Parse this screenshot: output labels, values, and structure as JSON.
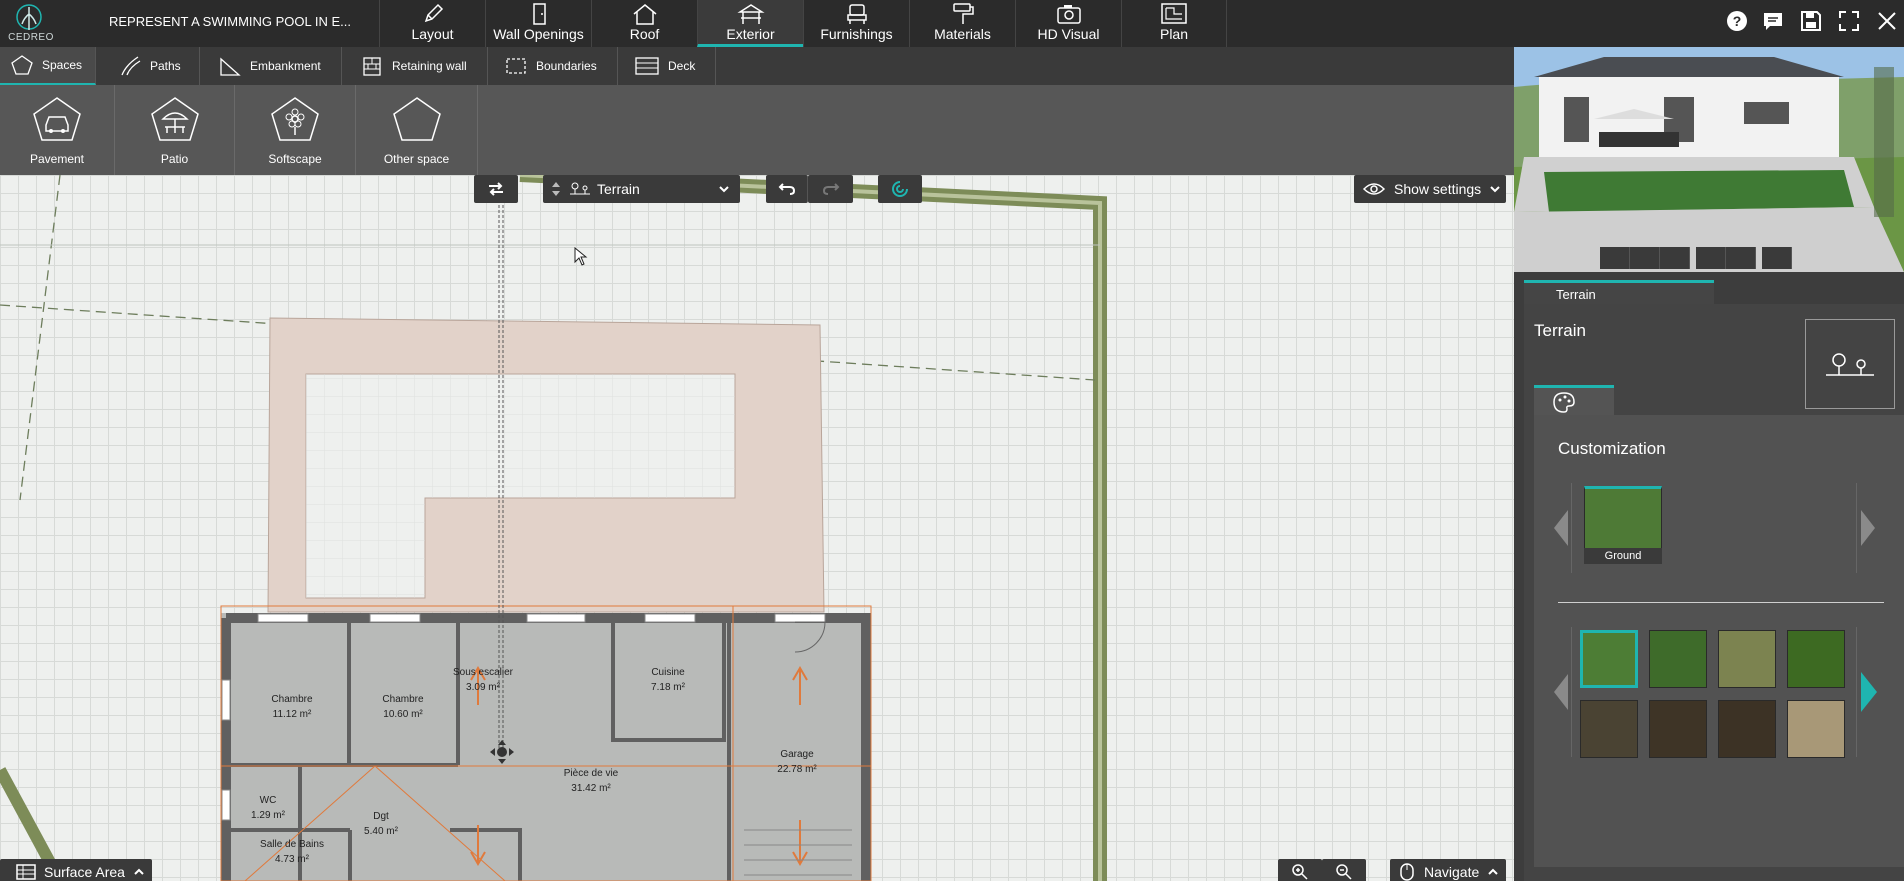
{
  "app": {
    "logo_text": "CEDREO",
    "project_title": "REPRESENT A SWIMMING POOL IN E..."
  },
  "main_tabs": [
    {
      "label": "Layout",
      "icon": "pencil-icon"
    },
    {
      "label": "Wall Openings",
      "icon": "door-icon"
    },
    {
      "label": "Roof",
      "icon": "roof-icon"
    },
    {
      "label": "Exterior",
      "icon": "gazebo-icon",
      "active": true
    },
    {
      "label": "Furnishings",
      "icon": "chair-icon"
    },
    {
      "label": "Materials",
      "icon": "paint-roller-icon"
    },
    {
      "label": "HD Visual",
      "icon": "camera-icon"
    },
    {
      "label": "Plan",
      "icon": "plan-icon"
    }
  ],
  "sub_tabs": [
    {
      "label": "Spaces",
      "active": true
    },
    {
      "label": "Paths"
    },
    {
      "label": "Embankment"
    },
    {
      "label": "Retaining wall"
    },
    {
      "label": "Boundaries"
    },
    {
      "label": "Deck"
    }
  ],
  "space_buttons": [
    {
      "label": "Pavement",
      "icon": "car-pentagon-icon"
    },
    {
      "label": "Patio",
      "icon": "parasol-pentagon-icon"
    },
    {
      "label": "Softscape",
      "icon": "flower-pentagon-icon"
    },
    {
      "label": "Other space",
      "icon": "pentagon-icon"
    }
  ],
  "canvas_controls": {
    "level_select": "Terrain",
    "show_settings": "Show settings",
    "surface_area": "Surface Area",
    "navigate": "Navigate"
  },
  "rooms": [
    {
      "name": "Chambre",
      "area": "11.12 m²"
    },
    {
      "name": "Chambre",
      "area": "10.60 m²"
    },
    {
      "name": "Sous escalier",
      "area": "3.09 m²"
    },
    {
      "name": "Cuisine",
      "area": "7.18 m²"
    },
    {
      "name": "Garage",
      "area": "22.78 m²"
    },
    {
      "name": "Pièce de vie",
      "area": "31.42 m²"
    },
    {
      "name": "WC",
      "area": "1.29 m²"
    },
    {
      "name": "Dgt",
      "area": "5.40 m²"
    },
    {
      "name": "Salle de Bains",
      "area": "4.73 m²"
    }
  ],
  "panel": {
    "tab_label": "Terrain",
    "title": "Terrain",
    "customization_title": "Customization",
    "selected_material": {
      "label": "Ground",
      "color": "#4e7a36"
    },
    "swatches": [
      {
        "color": "#4d7d35",
        "selected": true
      },
      {
        "color": "#3e6b2a"
      },
      {
        "color": "#7c8350"
      },
      {
        "color": "#3d6a22"
      },
      {
        "color": "#4a4333"
      },
      {
        "color": "#3e3426"
      },
      {
        "color": "#3c3225"
      },
      {
        "color": "#a89877"
      }
    ]
  },
  "colors": {
    "accent": "#1fb5b0",
    "topbar": "#2b2b2b",
    "patio": "#e2d2c9",
    "house_wall": "#606060",
    "orange": "#e07a3c"
  }
}
